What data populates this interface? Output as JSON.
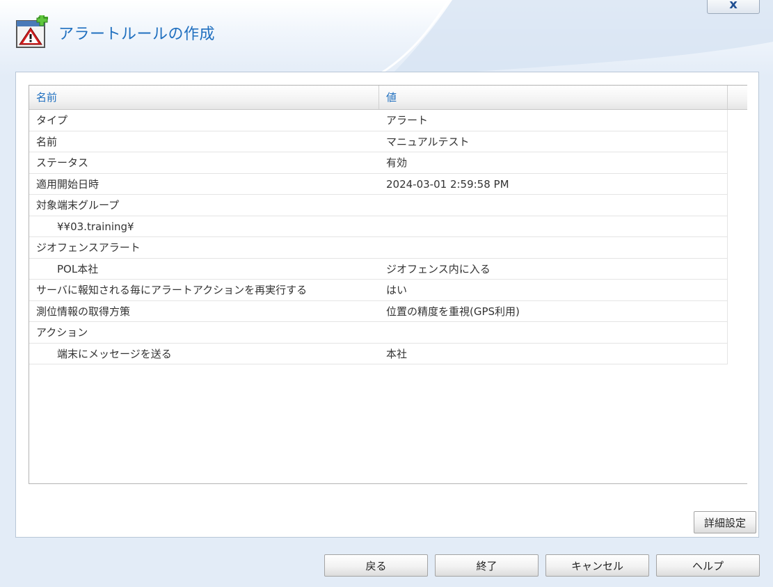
{
  "window": {
    "title": "アラートルールの作成",
    "close_label": "x"
  },
  "table": {
    "headers": {
      "name": "名前",
      "value": "値"
    },
    "rows": [
      {
        "name": "タイプ",
        "value": "アラート",
        "indent": false
      },
      {
        "name": "名前",
        "value": "マニュアルテスト",
        "indent": false
      },
      {
        "name": "ステータス",
        "value": "有効",
        "indent": false
      },
      {
        "name": "適用開始日時",
        "value": "2024-03-01 2:59:58 PM",
        "indent": false
      },
      {
        "name": "対象端末グループ",
        "value": "",
        "indent": false
      },
      {
        "name": "¥¥03.training¥",
        "value": "",
        "indent": true
      },
      {
        "name": "ジオフェンスアラート",
        "value": "",
        "indent": false
      },
      {
        "name": "POL本社",
        "value": "ジオフェンス内に入る",
        "indent": true
      },
      {
        "name": "サーバに報知される毎にアラートアクションを再実行する",
        "value": "はい",
        "indent": false
      },
      {
        "name": "測位情報の取得方策",
        "value": "位置の精度を重視(GPS利用)",
        "indent": false
      },
      {
        "name": "アクション",
        "value": "",
        "indent": false
      },
      {
        "name": "端末にメッセージを送る",
        "value": "本社",
        "indent": true
      }
    ]
  },
  "buttons": {
    "detail": "詳細設定",
    "back": "戻る",
    "finish": "終了",
    "cancel": "キャンセル",
    "help": "ヘルプ"
  },
  "icons": {
    "title_icon": "alert-rule-add-icon",
    "close_icon": "close-icon"
  },
  "colors": {
    "accent": "#1f6fbf",
    "background": "#e3ecf7"
  }
}
